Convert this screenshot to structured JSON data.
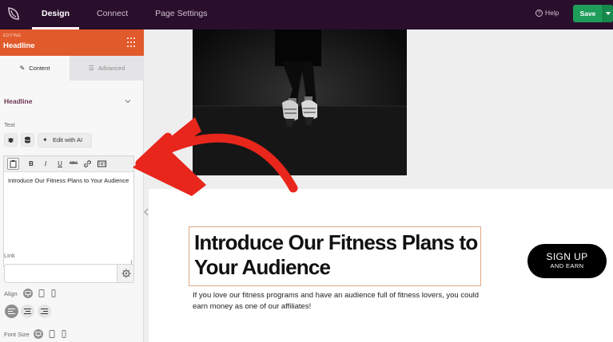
{
  "topbar": {
    "tabs": [
      {
        "label": "Design",
        "active": true
      },
      {
        "label": "Connect",
        "active": false
      },
      {
        "label": "Page Settings",
        "active": false
      }
    ],
    "help_label": "Help",
    "save_label": "Save",
    "accent": "#2a0f2c",
    "save_color": "#1e9c5a"
  },
  "panel": {
    "eyebrow": "EDITING",
    "title": "Headline",
    "header_color": "#e15a2b",
    "tabs": [
      {
        "label": "Content",
        "icon": "pencil-icon"
      },
      {
        "label": "Advanced",
        "icon": "sliders-icon"
      }
    ],
    "section_title": "Headline",
    "text_label": "Text",
    "ai_button_label": "Edit with AI",
    "editor_value": "Introduce Our Fitness Plans to Your Audience",
    "toolbar": {
      "bold": "B",
      "italic": "I",
      "underline": "U",
      "strike": "ABC"
    },
    "link_label": "Link",
    "link_value": "",
    "align_label": "Align",
    "font_size_label": "Font Size"
  },
  "canvas": {
    "headline": "Introduce Our Fitness Plans to Your Audience",
    "paragraph": "If you love our fitness programs and have an audience full of fitness lovers, you could earn money as one of our affiliates!",
    "cta_line1": "SIGN UP",
    "cta_line2": "AND EARN",
    "highlight_border": "#e0a985",
    "annotation_color": "#e8261c"
  }
}
